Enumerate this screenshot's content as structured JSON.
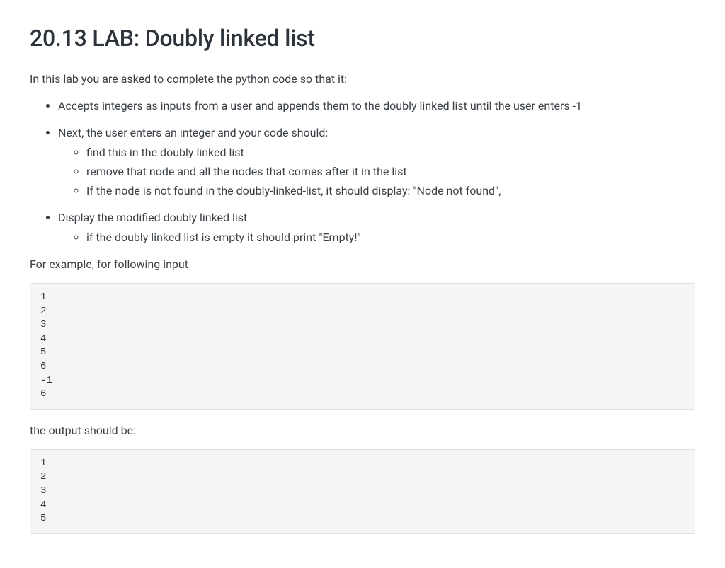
{
  "title": "20.13 LAB: Doubly linked list",
  "intro": "In this lab you are asked to complete the python code so that it:",
  "bullets": {
    "b1": "Accepts integers as inputs from a user and appends them to the doubly linked list until the user enters -1",
    "b2": "Next, the user enters an integer and your code should:",
    "b2_sub": {
      "s1": "find this in the doubly linked list",
      "s2": "remove that node and all the nodes that comes after it in the list",
      "s3": "If the node is not found in the doubly-linked-list, it should display: \"Node not found\","
    },
    "b3": "Display the modified doubly linked list",
    "b3_sub": {
      "s1": "if the doubly linked list is empty it should print \"Empty!\""
    }
  },
  "example_intro": "For example, for following input",
  "input_block": "1\n2\n3\n4\n5\n6\n-1\n6",
  "output_intro": "the output should be:",
  "output_block": "1\n2\n3\n4\n5"
}
